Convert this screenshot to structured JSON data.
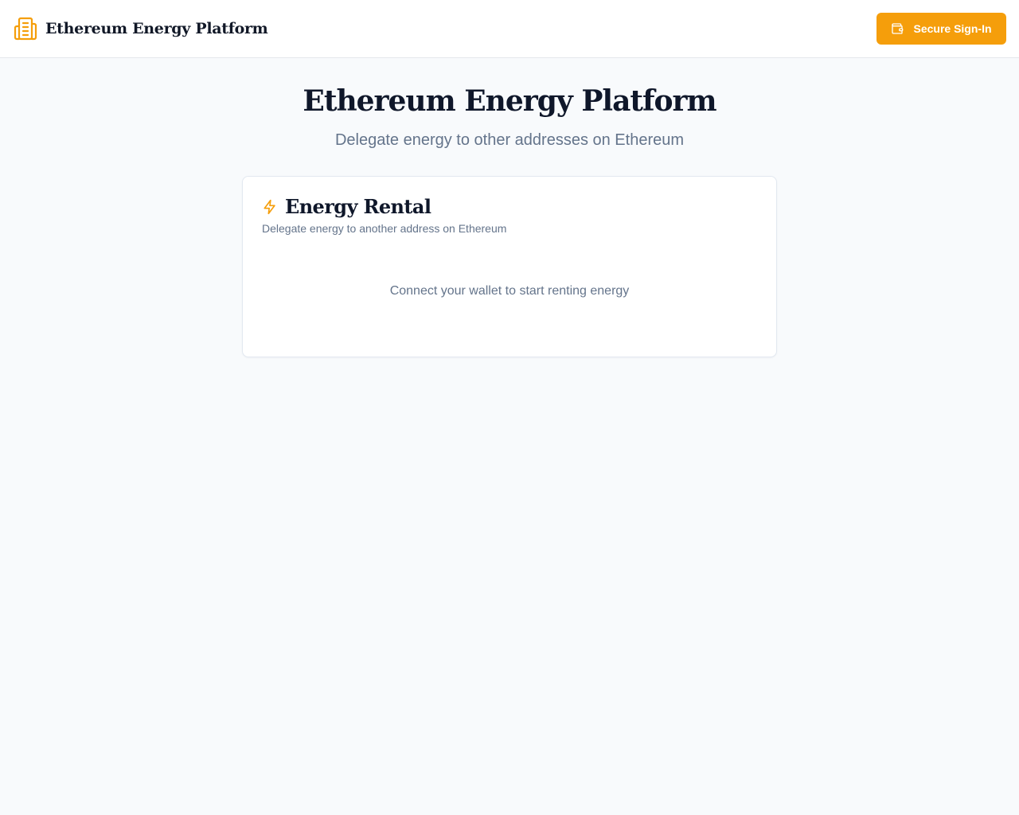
{
  "header": {
    "brand_title": "Ethereum Energy Platform",
    "brand_icon": "building-icon",
    "signin_label": "Secure Sign-In",
    "signin_icon": "wallet-icon"
  },
  "hero": {
    "title": "Ethereum Energy Platform",
    "subtitle": "Delegate energy to other addresses on Ethereum"
  },
  "card": {
    "icon": "lightning-bolt-icon",
    "title": "Energy Rental",
    "description": "Delegate energy to another address on Ethereum",
    "empty_message": "Connect your wallet to start renting energy"
  },
  "colors": {
    "accent": "#f59e0b",
    "page_background": "#f8fafc",
    "text_primary": "#0f172a",
    "text_muted": "#64748b"
  }
}
